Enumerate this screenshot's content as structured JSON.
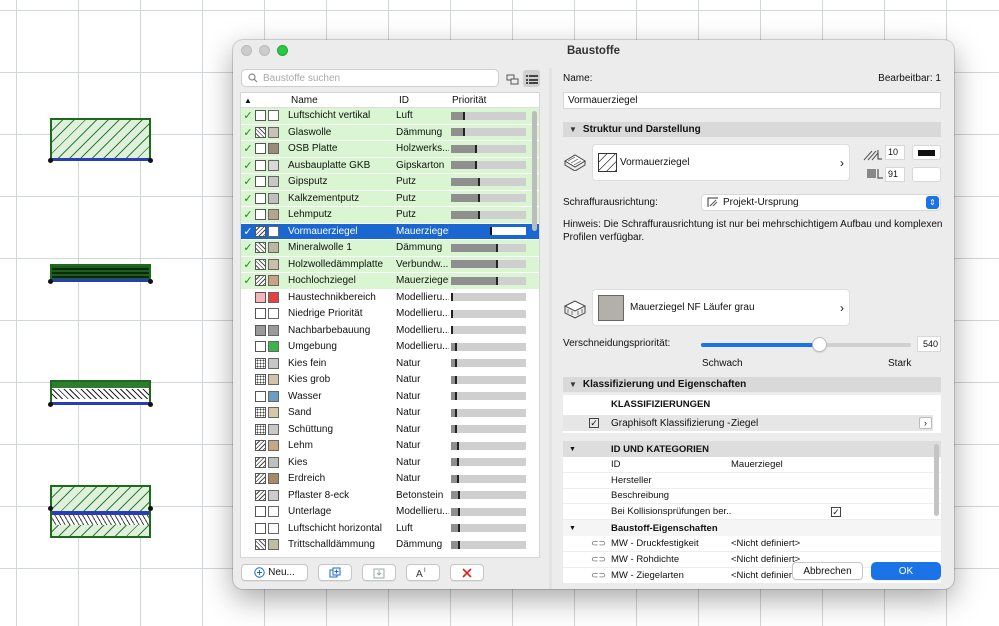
{
  "dialog": {
    "title": "Baustoffe"
  },
  "search": {
    "placeholder": "Baustoffe suchen"
  },
  "list": {
    "headers": {
      "sort": "▲",
      "name": "Name",
      "id": "ID",
      "priority": "Priorität"
    },
    "rows": [
      {
        "name": "Luftschicht vertikal",
        "id": "Luft",
        "checked": true,
        "selected": false,
        "color": "#ffffff",
        "pattern": "none",
        "prio": 0.18
      },
      {
        "name": "Glaswolle",
        "id": "Dämmung",
        "checked": true,
        "selected": false,
        "color": "#c8c2b4",
        "pattern": "insul",
        "prio": 0.18
      },
      {
        "name": "OSB Platte",
        "id": "Holzwerks...",
        "checked": true,
        "selected": false,
        "color": "#9a8c76",
        "pattern": "solid",
        "prio": 0.35
      },
      {
        "name": "Ausbauplatte GKB",
        "id": "Gipskarton",
        "checked": true,
        "selected": false,
        "color": "#d8d8d8",
        "pattern": "solid",
        "prio": 0.35
      },
      {
        "name": "Gipsputz",
        "id": "Putz",
        "checked": true,
        "selected": false,
        "color": "#c7c7c7",
        "pattern": "solid",
        "prio": 0.38
      },
      {
        "name": "Kalkzementputz",
        "id": "Putz",
        "checked": true,
        "selected": false,
        "color": "#bfbfbf",
        "pattern": "solid",
        "prio": 0.38
      },
      {
        "name": "Lehmputz",
        "id": "Putz",
        "checked": true,
        "selected": false,
        "color": "#b8a48e",
        "pattern": "solid",
        "prio": 0.38
      },
      {
        "name": "Vormauerziegel",
        "id": "Mauerziegel",
        "checked": true,
        "selected": true,
        "color": "#ffffff",
        "pattern": "hatch",
        "prio": 0.55
      },
      {
        "name": "Mineralwolle 1",
        "id": "Dämmung",
        "checked": true,
        "selected": false,
        "color": "#bdb6a6",
        "pattern": "insul",
        "prio": 0.62
      },
      {
        "name": "Holzwolledämmplatte",
        "id": "Verbundw...",
        "checked": true,
        "selected": false,
        "color": "#cbbfa8",
        "pattern": "insul",
        "prio": 0.62
      },
      {
        "name": "Hochlochziegel",
        "id": "Mauerziegel",
        "checked": true,
        "selected": false,
        "color": "#c9a184",
        "pattern": "hatch",
        "prio": 0.62
      },
      {
        "name": "Haustechnikbereich",
        "id": "Modellieru...",
        "checked": false,
        "selected": false,
        "color": "#e84040",
        "pattern": "pink",
        "prio": 0.02
      },
      {
        "name": "Niedrige Priorität",
        "id": "Modellieru...",
        "checked": false,
        "selected": false,
        "color": "#ffffff",
        "pattern": "none",
        "prio": 0.02
      },
      {
        "name": "Nachbarbebauung",
        "id": "Modellieru...",
        "checked": false,
        "selected": false,
        "color": "#9a9a9a",
        "pattern": "grey",
        "prio": 0.02
      },
      {
        "name": "Umgebung",
        "id": "Modellieru...",
        "checked": false,
        "selected": false,
        "color": "#39b54a",
        "pattern": "none",
        "prio": 0.08
      },
      {
        "name": "Kies fein",
        "id": "Natur",
        "checked": false,
        "selected": false,
        "color": "#c7c7c7",
        "pattern": "dots",
        "prio": 0.08
      },
      {
        "name": "Kies grob",
        "id": "Natur",
        "checked": false,
        "selected": false,
        "color": "#d2c2a8",
        "pattern": "dots",
        "prio": 0.08
      },
      {
        "name": "Wasser",
        "id": "Natur",
        "checked": false,
        "selected": false,
        "color": "#6d9ec2",
        "pattern": "solid",
        "prio": 0.08
      },
      {
        "name": "Sand",
        "id": "Natur",
        "checked": false,
        "selected": false,
        "color": "#d6c8a6",
        "pattern": "dots",
        "prio": 0.08
      },
      {
        "name": "Schüttung",
        "id": "Natur",
        "checked": false,
        "selected": false,
        "color": "#c8c8c8",
        "pattern": "dots",
        "prio": 0.08
      },
      {
        "name": "Lehm",
        "id": "Natur",
        "checked": false,
        "selected": false,
        "color": "#c8a787",
        "pattern": "hatch",
        "prio": 0.1
      },
      {
        "name": "Kies",
        "id": "Natur",
        "checked": false,
        "selected": false,
        "color": "#c0c0c0",
        "pattern": "hatch",
        "prio": 0.1
      },
      {
        "name": "Erdreich",
        "id": "Natur",
        "checked": false,
        "selected": false,
        "color": "#a88a68",
        "pattern": "hatch",
        "prio": 0.1
      },
      {
        "name": "Pflaster 8-eck",
        "id": "Betonstein",
        "checked": false,
        "selected": false,
        "color": "#cccccc",
        "pattern": "hatch",
        "prio": 0.12
      },
      {
        "name": "Unterlage",
        "id": "Modellieru...",
        "checked": false,
        "selected": false,
        "color": "#d0d0d0",
        "pattern": "none",
        "prio": 0.12
      },
      {
        "name": "Luftschicht horizontal",
        "id": "Luft",
        "checked": false,
        "selected": false,
        "color": "#ffffff",
        "pattern": "none",
        "prio": 0.12
      },
      {
        "name": "Trittschalldämmung",
        "id": "Dämmung",
        "checked": false,
        "selected": false,
        "color": "#c0bcaa",
        "pattern": "insul",
        "prio": 0.12
      }
    ]
  },
  "buttons": {
    "new": "Neu...",
    "cancel": "Abbrechen",
    "ok": "OK"
  },
  "right": {
    "name_label": "Name:",
    "editable": "Bearbeitbar: 1",
    "name_value": "Vormauerziegel",
    "sec_structure": "Struktur und Darstellung",
    "fill_name": "Vormauerziegel",
    "pen1": "10",
    "pen2": "91",
    "hatch_orient_label": "Schraffurausrichtung:",
    "hatch_orient_value": "Projekt-Ursprung",
    "hint": "Hinweis: Die Schraffurausrichtung ist nur bei mehrschichtigem Aufbau und komplexen Profilen verfügbar.",
    "surface_name": "Mauerziegel NF Läufer grau",
    "intersect_label": "Verschneidungspriorität:",
    "intersect_value": "540",
    "intersect_fraction": 0.56,
    "weak": "Schwach",
    "strong": "Stark",
    "sec_class": "Klassifizierung und Eigenschaften",
    "class_header": "KLASSIFIZIERUNGEN",
    "class_item": "Graphisoft Klassifizierung -...",
    "class_value": "Ziegel",
    "id_header": "ID UND KATEGORIEN",
    "props": [
      {
        "label": "ID",
        "value": "Mauerziegel"
      },
      {
        "label": "Hersteller",
        "value": ""
      },
      {
        "label": "Beschreibung",
        "value": ""
      },
      {
        "label": "Bei Kollisionsprüfungen ber...",
        "value": "",
        "checkbox": true
      }
    ],
    "bprops_header": "Baustoff-Eigenschaften",
    "bprops": [
      {
        "label": "MW - Druckfestigkeit",
        "value": "<Nicht definiert>"
      },
      {
        "label": "MW - Rohdichte",
        "value": "<Nicht definiert>"
      },
      {
        "label": "MW - Ziegelarten",
        "value": "<Nicht definiert>"
      }
    ]
  }
}
